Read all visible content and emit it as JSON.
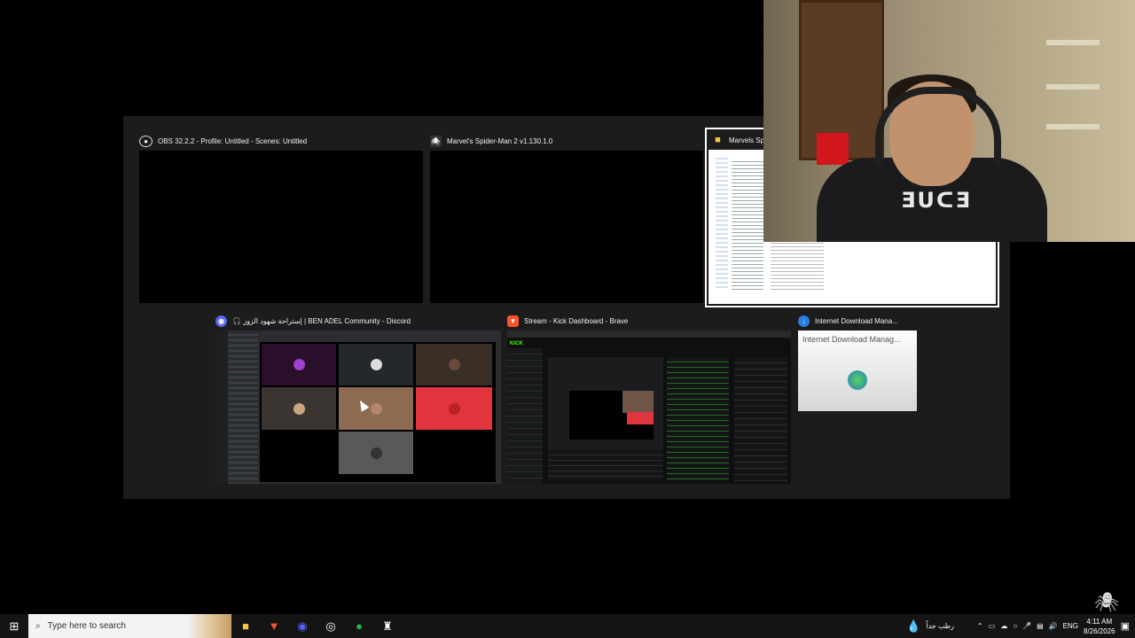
{
  "windows": {
    "obs": {
      "title": "OBS 32.2.2 - Profile: Untitled - Scenes: Untitled",
      "icon": "obs-icon"
    },
    "spiderman": {
      "title": "Marvel's Spider-Man 2 v1.130.1.0",
      "icon": "spider-man-icon"
    },
    "explorer": {
      "title": "Marvels Spi",
      "icon": "folder-icon"
    },
    "discord": {
      "title": "⁦🎧⁩ إستراحة شهود الزوز | BEN ADEL Community - Discord",
      "icon": "discord-icon"
    },
    "brave": {
      "title": "Stream - Kick Dashboard - Brave",
      "icon": "brave-icon"
    },
    "idm": {
      "title": "Internet Download Mana...",
      "thumb_label": "Internet Download Manag...",
      "icon": "idm-icon"
    }
  },
  "kick_logo": "KICK",
  "taskbar": {
    "search_placeholder": "Type here to search",
    "weather": "رطب جداً",
    "language": "ENG",
    "time": "4:11 AM",
    "date": "8/26/2026",
    "pinned": [
      "file-explorer-icon",
      "brave-icon",
      "discord-icon",
      "obs-icon",
      "spotify-icon",
      "spider-man-icon"
    ]
  },
  "colors": {
    "discord": "#5865f2",
    "brave": "#fb542b",
    "spotify": "#1db954",
    "kick": "#53fc18",
    "accent": "#e0343f"
  }
}
